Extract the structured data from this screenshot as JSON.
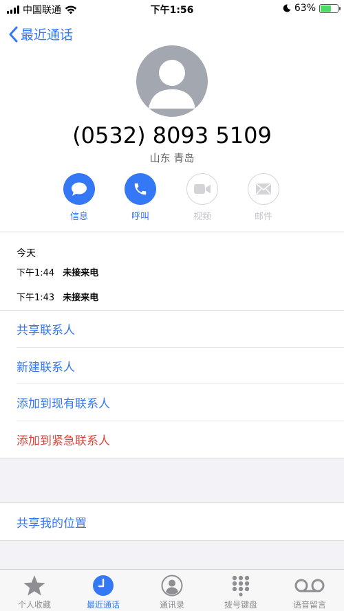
{
  "status_bar": {
    "carrier": "中国联通",
    "time": "下午1:56",
    "battery": "63%",
    "battery_level": 0.63
  },
  "nav": {
    "back_label": "最近通话"
  },
  "contact": {
    "number": "(0532) 8093 5109",
    "location": "山东 青岛"
  },
  "actions": [
    {
      "label": "信息",
      "icon": "message-icon",
      "enabled": true
    },
    {
      "label": "呼叫",
      "icon": "phone-icon",
      "enabled": true
    },
    {
      "label": "视频",
      "icon": "video-icon",
      "enabled": false
    },
    {
      "label": "邮件",
      "icon": "mail-icon",
      "enabled": false
    }
  ],
  "recents": {
    "header": "今天",
    "calls": [
      {
        "time": "下午1:44",
        "type": "未接来电"
      },
      {
        "time": "下午1:43",
        "type": "未接来电"
      }
    ]
  },
  "options": [
    {
      "label": "共享联系人"
    },
    {
      "label": "新建联系人"
    },
    {
      "label": "添加到现有联系人"
    },
    {
      "label": "添加到紧急联系人"
    }
  ],
  "share_location": "共享我的位置",
  "tabs": [
    {
      "label": "个人收藏",
      "icon": "star-icon",
      "active": false
    },
    {
      "label": "最近通话",
      "icon": "clock-icon",
      "active": true
    },
    {
      "label": "通讯录",
      "icon": "contacts-icon",
      "active": false
    },
    {
      "label": "拨号键盘",
      "icon": "keypad-icon",
      "active": false
    },
    {
      "label": "语音留言",
      "icon": "voicemail-icon",
      "active": false
    }
  ],
  "colors": {
    "accent": "#3478f6",
    "danger": "#e0443a",
    "disabled": "#c7c7cc"
  }
}
